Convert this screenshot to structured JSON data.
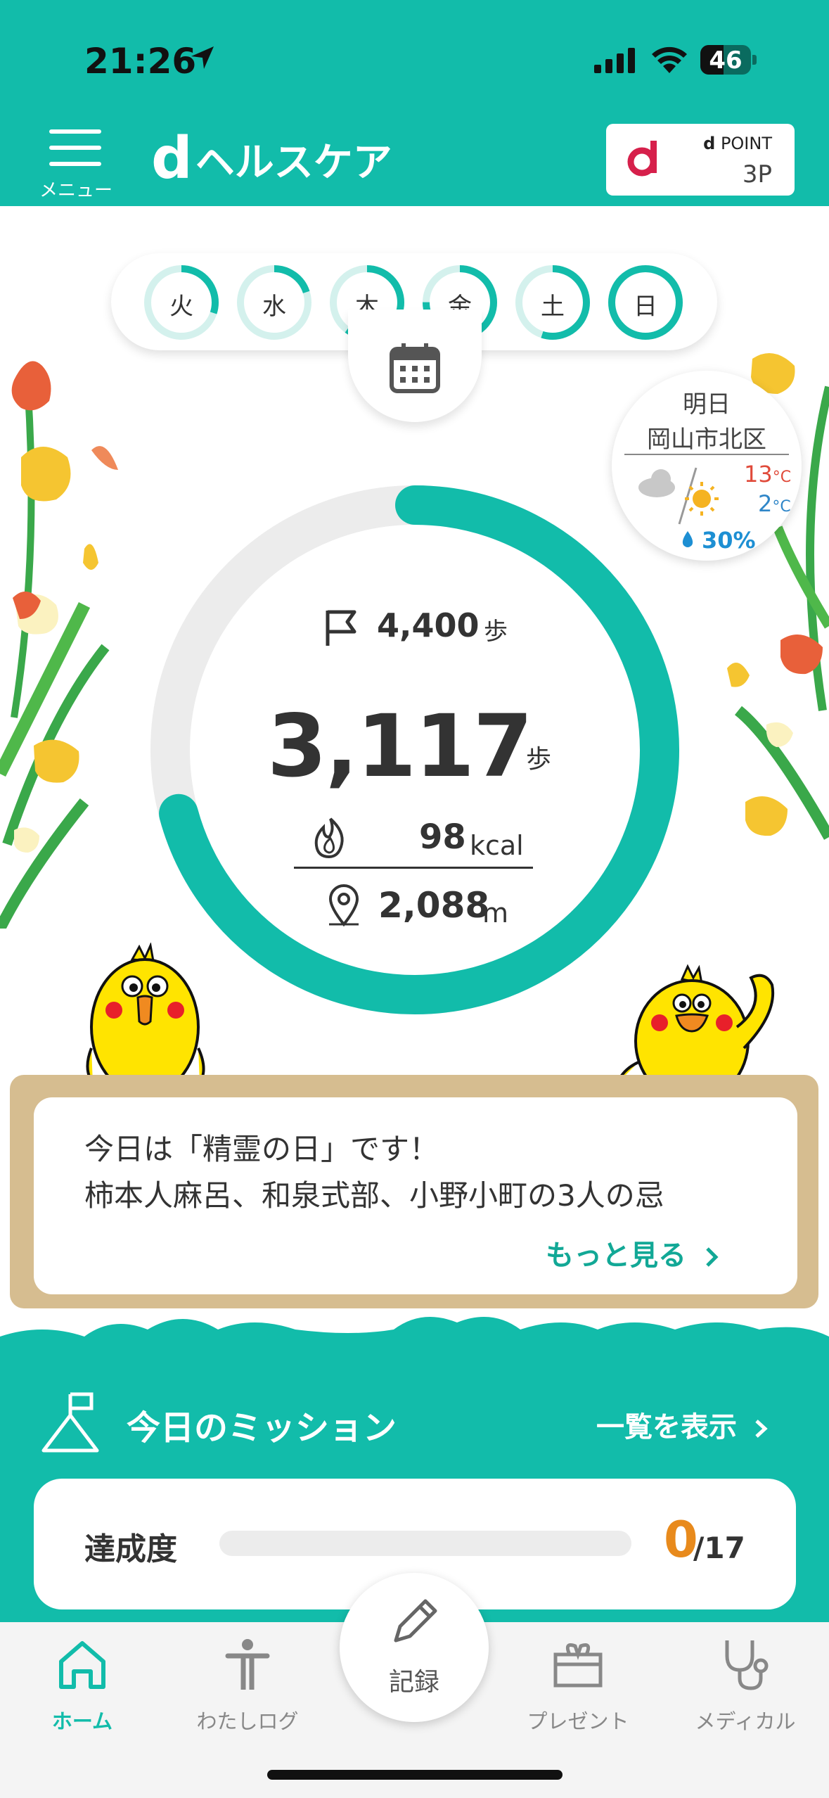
{
  "status_bar": {
    "time": "21:26",
    "battery": "46",
    "battery_level": 0.46
  },
  "header": {
    "menu_label": "メニュー",
    "logo_d": "d",
    "logo_text": "ヘルスケア",
    "dpoint_label": "POINT",
    "dpoint_d": "d",
    "dpoint_value": "3P"
  },
  "week": {
    "days": [
      {
        "label": "火",
        "progress": 0.3
      },
      {
        "label": "水",
        "progress": 0.2
      },
      {
        "label": "木",
        "progress": 0.6
      },
      {
        "label": "金",
        "progress": 0.75
      },
      {
        "label": "土",
        "progress": 0.55
      },
      {
        "label": "日",
        "progress": 1.0
      }
    ],
    "calendar_icon": "calendar-icon"
  },
  "weather": {
    "day": "明日",
    "city": "岡山市北区",
    "high": "13",
    "low": "2",
    "unit": "°C",
    "rain": "30%",
    "icons": [
      "cloud-icon",
      "sun-icon"
    ]
  },
  "activity": {
    "goal_steps": "4,400",
    "goal_unit": "歩",
    "steps": "3,117",
    "steps_unit": "歩",
    "progress": 0.708,
    "kcal": "98",
    "kcal_unit": "kcal",
    "distance": "2,088",
    "distance_unit": "m"
  },
  "news": {
    "line1": "今日は「精霊の日」です！",
    "line2": "柿本人麻呂、和泉式部、小野小町の3人の忌",
    "more": "もっと見る"
  },
  "mission": {
    "title": "今日のミッション",
    "view_all": "一覧を表示",
    "progress_label": "達成度",
    "done": "0",
    "total": "/17",
    "ratio": 0
  },
  "tabs": [
    {
      "label": "ホーム",
      "icon": "home-icon",
      "active": true
    },
    {
      "label": "わたしログ",
      "icon": "person-icon",
      "active": false
    },
    {
      "label": "記録",
      "icon": "pencil-icon",
      "active": false
    },
    {
      "label": "プレゼント",
      "icon": "gift-icon",
      "active": false
    },
    {
      "label": "メディカル",
      "icon": "stethoscope-icon",
      "active": false
    }
  ],
  "colors": {
    "brand": "#12bcaa",
    "accent_orange": "#e88a1c",
    "track": "#ececec"
  }
}
